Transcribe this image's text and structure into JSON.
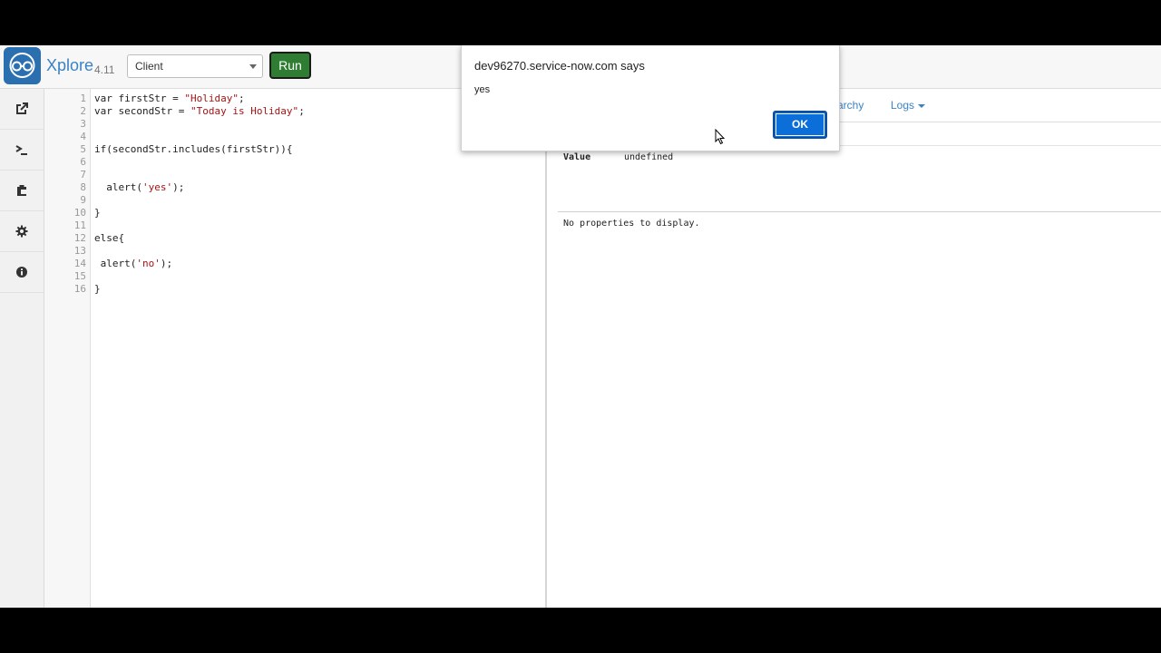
{
  "header": {
    "brand": "Xplore",
    "version": "4.11",
    "mode_select": {
      "selected": "Client"
    },
    "run_label": "Run"
  },
  "sidebar": {
    "items": [
      {
        "icon": "external-link-icon"
      },
      {
        "icon": "terminal-icon"
      },
      {
        "icon": "clipboard-icon"
      },
      {
        "icon": "gear-icon"
      },
      {
        "icon": "info-icon"
      }
    ]
  },
  "editor": {
    "line_numbers": [
      "1",
      "2",
      "3",
      "4",
      "5",
      "6",
      "7",
      "8",
      "9",
      "10",
      "11",
      "12",
      "13",
      "14",
      "15",
      "16"
    ],
    "lines": [
      {
        "pre": "var firstStr = ",
        "str": "\"Holiday\"",
        "post": ";"
      },
      {
        "pre": "var secondStr = ",
        "str": "\"Today is Holiday\"",
        "post": ";"
      },
      {
        "pre": "",
        "str": "",
        "post": ""
      },
      {
        "pre": "",
        "str": "",
        "post": ""
      },
      {
        "pre": "if(secondStr.includes(firstStr)){",
        "str": "",
        "post": ""
      },
      {
        "pre": "",
        "str": "",
        "post": ""
      },
      {
        "pre": "",
        "str": "",
        "post": ""
      },
      {
        "pre": "  alert(",
        "str": "'yes'",
        "post": ");"
      },
      {
        "pre": "",
        "str": "",
        "post": ""
      },
      {
        "pre": "}",
        "str": "",
        "post": ""
      },
      {
        "pre": "",
        "str": "",
        "post": ""
      },
      {
        "pre": "else{",
        "str": "",
        "post": ""
      },
      {
        "pre": "",
        "str": "",
        "post": ""
      },
      {
        "pre": " alert(",
        "str": "'no'",
        "post": ");"
      },
      {
        "pre": "",
        "str": "",
        "post": ""
      },
      {
        "pre": "}",
        "str": "",
        "post": ""
      }
    ]
  },
  "result": {
    "tabs": {
      "hierarchy": "archy",
      "logs": "Logs"
    },
    "value_label": "Value",
    "value": "undefined",
    "no_properties": "No properties to display."
  },
  "dialog": {
    "title": "dev96270.service-now.com says",
    "message": "yes",
    "ok_label": "OK"
  },
  "colors": {
    "brand": "#3b82c4",
    "run": "#2e7d32",
    "ok": "#0b6ed9",
    "string": "#a31515"
  }
}
